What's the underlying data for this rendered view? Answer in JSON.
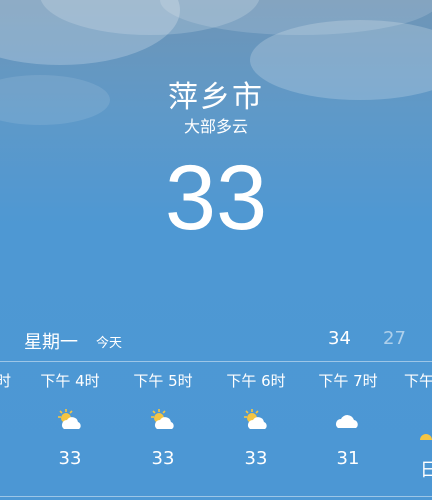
{
  "location": {
    "city": "萍乡市",
    "condition": "大部多云"
  },
  "current": {
    "temperature": "33"
  },
  "day": {
    "weekday": "星期一",
    "today_label": "今天",
    "high": "34",
    "low": "27"
  },
  "hourly_partial_left": "时",
  "hourly": [
    {
      "time": "下午 4时",
      "icon": "partly-sunny-icon",
      "temp": "33"
    },
    {
      "time": "下午 5时",
      "icon": "partly-sunny-icon",
      "temp": "33"
    },
    {
      "time": "下午 6时",
      "icon": "partly-sunny-icon",
      "temp": "33"
    },
    {
      "time": "下午 7时",
      "icon": "cloud-icon",
      "temp": "31"
    }
  ],
  "hourly_partial_right": {
    "time": "下午",
    "temp": "日"
  },
  "colors": {
    "sky_top": "#6f95b6",
    "sky_bottom": "#4c97d4",
    "sun": "#f5c542"
  }
}
